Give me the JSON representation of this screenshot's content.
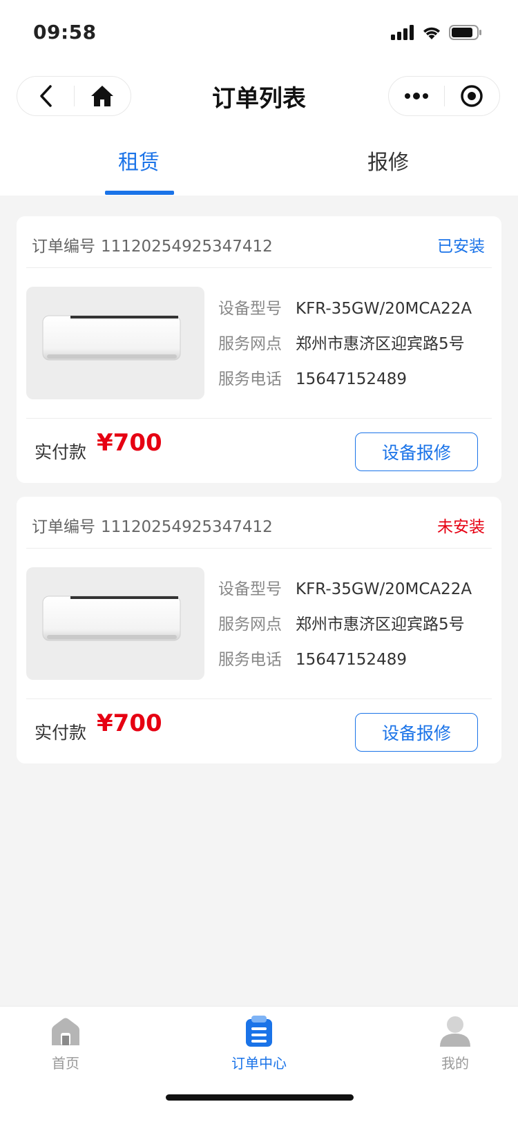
{
  "status_bar": {
    "time": "09:58"
  },
  "nav": {
    "title": "订单列表"
  },
  "tabs": [
    {
      "label": "租赁",
      "active": true
    },
    {
      "label": "报修",
      "active": false
    }
  ],
  "orders": [
    {
      "order_no_label": "订单编号",
      "order_no": "11120254925347412",
      "status": "已安装",
      "status_color": "#1a73e8",
      "model_label": "设备型号",
      "model": "KFR-35GW/20MCA22A",
      "outlet_label": "服务网点",
      "outlet": "郑州市惠济区迎宾路5号",
      "phone_label": "服务电话",
      "phone": "15647152489",
      "paid_label": "实付款",
      "paid_amount": "¥700",
      "action_label": "设备报修"
    },
    {
      "order_no_label": "订单编号",
      "order_no": "11120254925347412",
      "status": "未安装",
      "status_color": "#e60012",
      "model_label": "设备型号",
      "model": "KFR-35GW/20MCA22A",
      "outlet_label": "服务网点",
      "outlet": "郑州市惠济区迎宾路5号",
      "phone_label": "服务电话",
      "phone": "15647152489",
      "paid_label": "实付款",
      "paid_amount": "¥700",
      "action_label": "设备报修"
    }
  ],
  "tabbar": {
    "items": [
      {
        "label": "首页",
        "icon": "home-icon",
        "active": false
      },
      {
        "label": "订单中心",
        "icon": "order-icon",
        "active": true
      },
      {
        "label": "我的",
        "icon": "user-icon",
        "active": false
      }
    ],
    "active_color": "#1a73e8",
    "inactive_color": "#999999"
  }
}
